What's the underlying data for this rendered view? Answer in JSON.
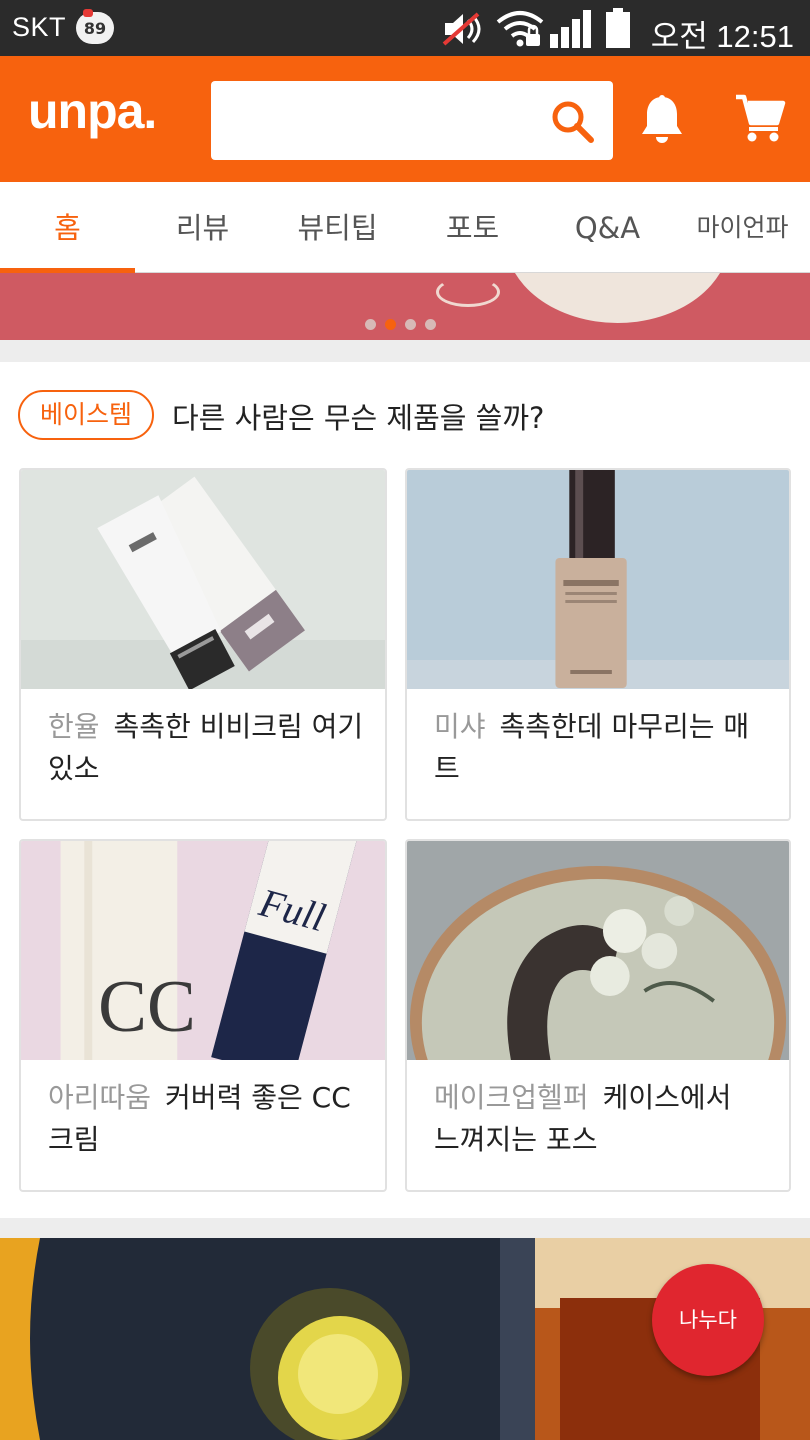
{
  "status_bar": {
    "carrier": "SKT",
    "notification_badge": "89",
    "time": "오전 12:51",
    "icons": [
      "mute-icon",
      "wifi-icon",
      "signal-icon",
      "battery-icon"
    ]
  },
  "header": {
    "logo": "unpa.",
    "search_placeholder": "",
    "brand_color": "#f7620e"
  },
  "tabs": [
    {
      "label": "홈",
      "active": true
    },
    {
      "label": "리뷰",
      "active": false
    },
    {
      "label": "뷰티팁",
      "active": false
    },
    {
      "label": "포토",
      "active": false
    },
    {
      "label": "Q&A",
      "active": false
    },
    {
      "label": "마이언파",
      "active": false
    }
  ],
  "banner": {
    "page_count": 4,
    "active_page": 2
  },
  "section": {
    "tag": "베이스템",
    "title": "다른 사람은 무슨 제품을 쓸까?",
    "cards": [
      {
        "brand": "한율",
        "title": "촉촉한 비비크림 여기있소",
        "image": "bb-cream-tube-photo"
      },
      {
        "brand": "미샤",
        "title": "촉촉한데 마무리는 매트",
        "image": "foundation-bottle-photo"
      },
      {
        "brand": "아리따움",
        "title": "커버력 좋은 CC크림",
        "image": "cc-cream-tubes-photo"
      },
      {
        "brand": "메이크업헬퍼",
        "title": "케이스에서 느껴지는 포스",
        "image": "cushion-compact-photo"
      }
    ]
  },
  "share_button": {
    "label": "나누다",
    "color": "#e0262f"
  }
}
